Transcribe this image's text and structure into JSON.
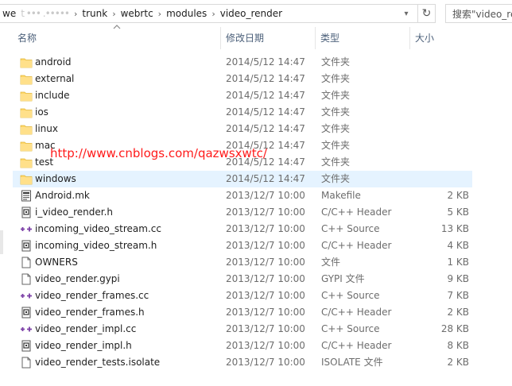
{
  "address": {
    "crumbs": [
      "trunk",
      "webrtc",
      "modules",
      "video_render"
    ],
    "first_partial": "we",
    "blurred": "t ••• .•••••"
  },
  "search": {
    "placeholder": "搜索\"video_re"
  },
  "columns": {
    "name": "名称",
    "date": "修改日期",
    "type": "类型",
    "size": "大小"
  },
  "watermark": "http://www.cnblogs.com/qazwsxwtc/",
  "files": [
    {
      "name": "android",
      "date": "2014/5/12 14:47",
      "type": "文件夹",
      "size": "",
      "icon": "folder-icon"
    },
    {
      "name": "external",
      "date": "2014/5/12 14:47",
      "type": "文件夹",
      "size": "",
      "icon": "folder-icon"
    },
    {
      "name": "include",
      "date": "2014/5/12 14:47",
      "type": "文件夹",
      "size": "",
      "icon": "folder-icon"
    },
    {
      "name": "ios",
      "date": "2014/5/12 14:47",
      "type": "文件夹",
      "size": "",
      "icon": "folder-icon"
    },
    {
      "name": "linux",
      "date": "2014/5/12 14:47",
      "type": "文件夹",
      "size": "",
      "icon": "folder-icon"
    },
    {
      "name": "mac",
      "date": "2014/5/12 14:47",
      "type": "文件夹",
      "size": "",
      "icon": "folder-icon"
    },
    {
      "name": "test",
      "date": "2014/5/12 14:47",
      "type": "文件夹",
      "size": "",
      "icon": "folder-icon"
    },
    {
      "name": "windows",
      "date": "2014/5/12 14:47",
      "type": "文件夹",
      "size": "",
      "icon": "folder-icon",
      "selected": true
    },
    {
      "name": "Android.mk",
      "date": "2013/12/7 10:00",
      "type": "Makefile",
      "size": "2 KB",
      "icon": "makefile-icon"
    },
    {
      "name": "i_video_render.h",
      "date": "2013/12/7 10:00",
      "type": "C/C++ Header",
      "size": "5 KB",
      "icon": "header-file-icon"
    },
    {
      "name": "incoming_video_stream.cc",
      "date": "2013/12/7 10:00",
      "type": "C++ Source",
      "size": "13 KB",
      "icon": "cpp-source-icon"
    },
    {
      "name": "incoming_video_stream.h",
      "date": "2013/12/7 10:00",
      "type": "C/C++ Header",
      "size": "4 KB",
      "icon": "header-file-icon"
    },
    {
      "name": "OWNERS",
      "date": "2013/12/7 10:00",
      "type": "文件",
      "size": "1 KB",
      "icon": "blank-file-icon"
    },
    {
      "name": "video_render.gypi",
      "date": "2013/12/7 10:00",
      "type": "GYPI 文件",
      "size": "9 KB",
      "icon": "blank-file-icon"
    },
    {
      "name": "video_render_frames.cc",
      "date": "2013/12/7 10:00",
      "type": "C++ Source",
      "size": "7 KB",
      "icon": "cpp-source-icon"
    },
    {
      "name": "video_render_frames.h",
      "date": "2013/12/7 10:00",
      "type": "C/C++ Header",
      "size": "2 KB",
      "icon": "header-file-icon"
    },
    {
      "name": "video_render_impl.cc",
      "date": "2013/12/7 10:00",
      "type": "C++ Source",
      "size": "28 KB",
      "icon": "cpp-source-icon"
    },
    {
      "name": "video_render_impl.h",
      "date": "2013/12/7 10:00",
      "type": "C/C++ Header",
      "size": "8 KB",
      "icon": "header-file-icon"
    },
    {
      "name": "video_render_tests.isolate",
      "date": "2013/12/7 10:00",
      "type": "ISOLATE 文件",
      "size": "2 KB",
      "icon": "blank-file-icon"
    }
  ],
  "colors": {
    "selection": "#e5f3ff",
    "folder": "#ffd767",
    "watermark": "#ff1a1a",
    "header_text": "#4c607a"
  }
}
